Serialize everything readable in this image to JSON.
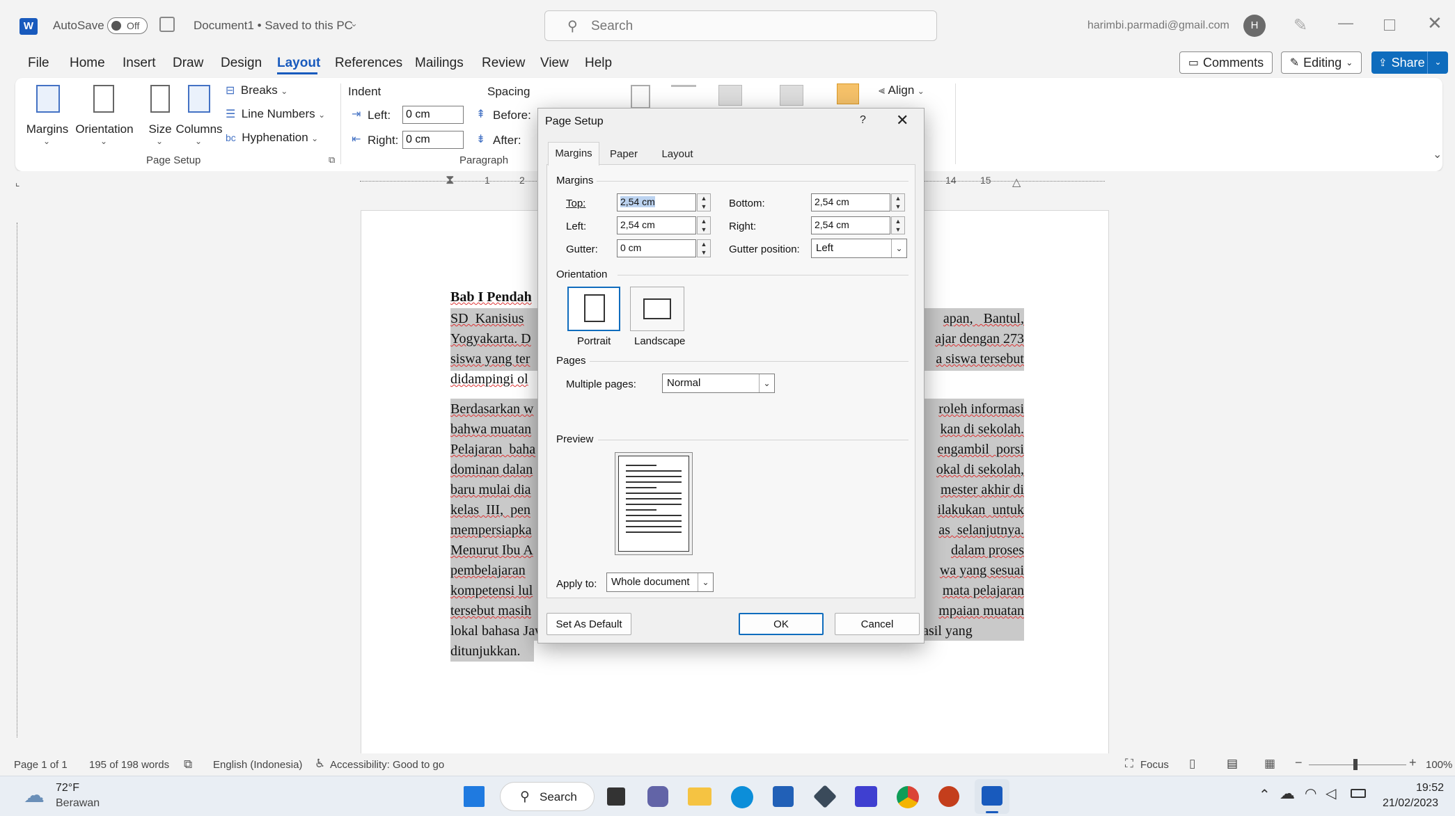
{
  "titlebar": {
    "app_icon": "W",
    "autosave_label": "AutoSave",
    "autosave_state": "Off",
    "document_title": "Document1 • Saved to this PC",
    "search_placeholder": "Search",
    "user_email": "harimbi.parmadi@gmail.com",
    "avatar_initial": "H"
  },
  "menu": {
    "items": [
      "File",
      "Home",
      "Insert",
      "Draw",
      "Design",
      "Layout",
      "References",
      "Mailings",
      "Review",
      "View",
      "Help"
    ],
    "active": "Layout",
    "comments_label": "Comments",
    "editing_label": "Editing",
    "share_label": "Share"
  },
  "ribbon": {
    "margins": "Margins",
    "orientation": "Orientation",
    "size": "Size",
    "columns": "Columns",
    "breaks": "Breaks",
    "line_numbers": "Line Numbers",
    "hyphenation": "Hyphenation",
    "page_setup_group": "Page Setup",
    "indent_header": "Indent",
    "indent_left_label": "Left:",
    "indent_left_value": "0 cm",
    "indent_right_label": "Right:",
    "indent_right_value": "0 cm",
    "spacing_header": "Spacing",
    "before_label": "Before:",
    "after_label": "After:",
    "paragraph_group": "Paragraph",
    "align": "Align"
  },
  "ruler": {
    "marks": [
      "1",
      "2",
      "14",
      "15"
    ]
  },
  "document": {
    "heading": "Bab I Pendah",
    "p1_lines": [
      {
        "left": "SD  Kanisius",
        "right": "apan,   Bantul,"
      },
      {
        "left": "Yogyakarta. D",
        "right": "ajar dengan 273"
      },
      {
        "left": "siswa yang ter",
        "right": "a siswa tersebut"
      },
      {
        "left": "didampingi ol",
        "right": ""
      }
    ],
    "p2_lines": [
      {
        "left": "Berdasarkan w",
        "right": "roleh informasi"
      },
      {
        "left": "bahwa muatan",
        "right": "kan di sekolah."
      },
      {
        "left": "Pelajaran  baha",
        "right": "engambil  porsi"
      },
      {
        "left": "dominan dalan",
        "right": "okal di sekolah,"
      },
      {
        "left": "baru mulai dia",
        "right": "mester akhir di"
      },
      {
        "left": "kelas  III,  pen",
        "right": "ilakukan  untuk"
      },
      {
        "left": "mempersiapka",
        "right": "as  selanjutnya."
      },
      {
        "left": "Menurut Ibu A",
        "right": "dalam proses"
      },
      {
        "left": "pembelajaran",
        "right": "wa yang sesuai"
      },
      {
        "left": "kompetensi lul",
        "right": "mata pelajaran"
      },
      {
        "left": "tersebut masih",
        "right": "mpaian muatan"
      }
    ],
    "p2_full_line": "lokal bahasa Jawa di sekolah belum dapat dikatakan maksimal dari segi proses dan hasil yang",
    "p2_last_line": "ditunjukkan."
  },
  "dialog": {
    "title": "Page Setup",
    "help": "?",
    "tabs": [
      "Margins",
      "Paper",
      "Layout"
    ],
    "active_tab": "Margins",
    "margins_section": "Margins",
    "top_label": "Top:",
    "top_value": "2,54 cm",
    "bottom_label": "Bottom:",
    "bottom_value": "2,54 cm",
    "left_label": "Left:",
    "left_value": "2,54 cm",
    "right_label": "Right:",
    "right_value": "2,54 cm",
    "gutter_label": "Gutter:",
    "gutter_value": "0 cm",
    "gutter_pos_label": "Gutter position:",
    "gutter_pos_value": "Left",
    "orientation_section": "Orientation",
    "portrait": "Portrait",
    "landscape": "Landscape",
    "pages_section": "Pages",
    "multiple_pages_label": "Multiple pages:",
    "multiple_pages_value": "Normal",
    "preview_section": "Preview",
    "apply_to_label": "Apply to:",
    "apply_to_value": "Whole document",
    "set_default": "Set As Default",
    "ok": "OK",
    "cancel": "Cancel"
  },
  "status": {
    "page": "Page 1 of 1",
    "words": "195 of 198 words",
    "language": "English (Indonesia)",
    "accessibility": "Accessibility: Good to go",
    "focus": "Focus",
    "zoom": "100%"
  },
  "taskbar": {
    "weather_temp": "72°F",
    "weather_desc": "Berawan",
    "search_label": "Search",
    "time": "19:52",
    "date": "21/02/2023"
  },
  "colors": {
    "accent": "#0f6cbd",
    "word_blue": "#185abd",
    "selection": "#c9c9c9"
  }
}
